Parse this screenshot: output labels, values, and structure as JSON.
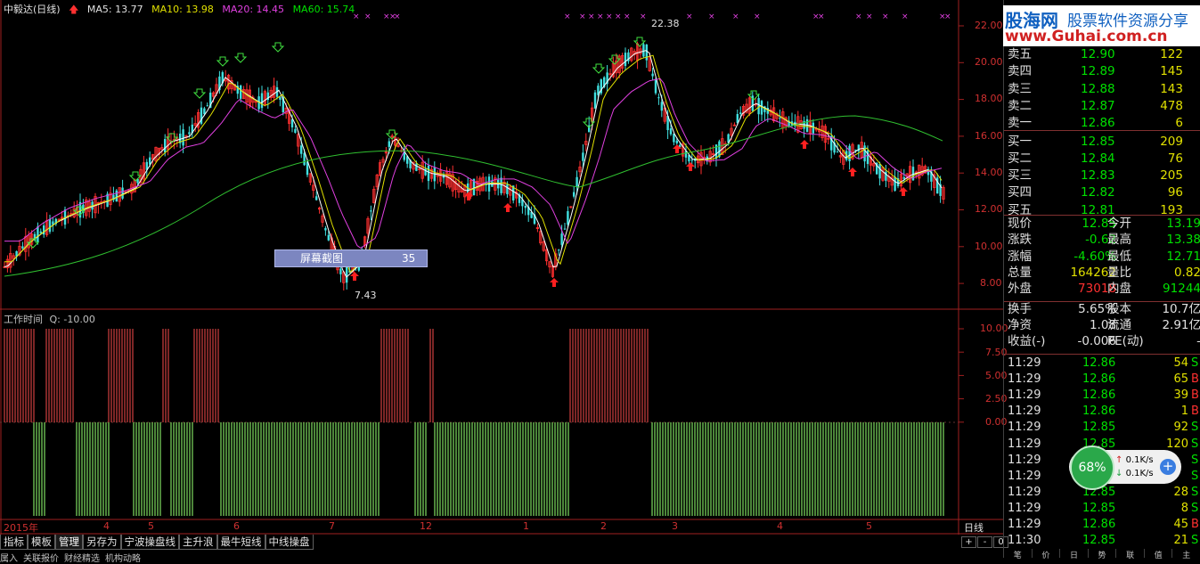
{
  "header": {
    "stock": "中毅达(日线)",
    "ma5": "MA5: 13.77",
    "ma10": "MA10: 13.98",
    "ma20": "MA20: 14.45",
    "ma60": "MA60: 15.74"
  },
  "price_axis": [
    "22.00",
    "20.00",
    "18.00",
    "16.00",
    "14.00",
    "12.00",
    "10.00",
    "8.00"
  ],
  "annotations": {
    "high": "22.38",
    "low": "7.43"
  },
  "overlay": {
    "label": "屏幕截图",
    "value": "35"
  },
  "indicator": {
    "title": "工作时间",
    "q": "Q: -10.00",
    "axis": [
      "10.00",
      "7.50",
      "5.00",
      "2.50",
      "0.00"
    ]
  },
  "dates": [
    "2015年",
    "4",
    "5",
    "6",
    "7",
    "12",
    "1",
    "2",
    "3",
    "4",
    "5"
  ],
  "day_label": "日线",
  "nav": [
    "+",
    "-",
    "0"
  ],
  "tabs": [
    "指标",
    "模板",
    "管理",
    "另存为",
    "宁波操盘线",
    "主升浪",
    "最牛短线",
    "中线操盘"
  ],
  "subtabs": [
    "属入",
    "关联报价",
    "财经精选",
    "机构动略"
  ],
  "logo": {
    "site": "股海网",
    "slogan": "股票软件资源分享",
    "url": "www.Guhai.com.cn"
  },
  "order_book": [
    {
      "label": "卖五",
      "price": "12.90",
      "vol": "122"
    },
    {
      "label": "卖四",
      "price": "12.89",
      "vol": "145"
    },
    {
      "label": "卖三",
      "price": "12.88",
      "vol": "143"
    },
    {
      "label": "卖二",
      "price": "12.87",
      "vol": "478"
    },
    {
      "label": "卖一",
      "price": "12.86",
      "vol": "6"
    },
    {
      "label": "买一",
      "price": "12.85",
      "vol": "209"
    },
    {
      "label": "买二",
      "price": "12.84",
      "vol": "76"
    },
    {
      "label": "买三",
      "price": "12.83",
      "vol": "205"
    },
    {
      "label": "买四",
      "price": "12.82",
      "vol": "96"
    },
    {
      "label": "买五",
      "price": "12.81",
      "vol": "193"
    }
  ],
  "quote": [
    {
      "l1": "现价",
      "v1": "12.85",
      "c1": "#00e000",
      "l2": "今开",
      "v2": "13.19",
      "c2": "#00e000"
    },
    {
      "l1": "涨跌",
      "v1": "-0.62",
      "c1": "#00e000",
      "l2": "最高",
      "v2": "13.38",
      "c2": "#00e000"
    },
    {
      "l1": "涨幅",
      "v1": "-4.60%",
      "c1": "#00e000",
      "l2": "最低",
      "v2": "12.71",
      "c2": "#00e000"
    },
    {
      "l1": "总量",
      "v1": "164262",
      "c1": "#e0e000",
      "l2": "量比",
      "v2": "0.82",
      "c2": "#e0e000"
    },
    {
      "l1": "外盘",
      "v1": "73018",
      "c1": "#ff3030",
      "l2": "内盘",
      "v2": "91244",
      "c2": "#00e000"
    },
    {
      "l1": "换手",
      "v1": "5.65%",
      "c1": "#e0e0e0",
      "l2": "股本",
      "v2": "10.7亿",
      "c2": "#e0e0e0"
    },
    {
      "l1": "净资",
      "v1": "1.08",
      "c1": "#e0e0e0",
      "l2": "流通",
      "v2": "2.91亿",
      "c2": "#e0e0e0"
    },
    {
      "l1": "收益(-)",
      "v1": "-0.006",
      "c1": "#e0e0e0",
      "l2": "PE(动)",
      "v2": "-",
      "c2": "#e0e0e0"
    }
  ],
  "ticks": [
    {
      "time": "11:29",
      "price": "12.86",
      "vol": "54",
      "dir": "S"
    },
    {
      "time": "11:29",
      "price": "12.86",
      "vol": "65",
      "dir": "B"
    },
    {
      "time": "11:29",
      "price": "12.86",
      "vol": "39",
      "dir": "B"
    },
    {
      "time": "11:29",
      "price": "12.86",
      "vol": "1",
      "dir": "B"
    },
    {
      "time": "11:29",
      "price": "12.85",
      "vol": "92",
      "dir": "S"
    },
    {
      "time": "11:29",
      "price": "12.85",
      "vol": "120",
      "dir": "S"
    },
    {
      "time": "11:29",
      "price": "12.85",
      "vol": "",
      "dir": "S"
    },
    {
      "time": "11:29",
      "price": "12.85",
      "vol": "",
      "dir": "S"
    },
    {
      "time": "11:29",
      "price": "12.85",
      "vol": "28",
      "dir": "S"
    },
    {
      "time": "11:29",
      "price": "12.85",
      "vol": "8",
      "dir": "S"
    },
    {
      "time": "11:29",
      "price": "12.86",
      "vol": "45",
      "dir": "B"
    },
    {
      "time": "11:30",
      "price": "12.85",
      "vol": "21",
      "dir": "S"
    }
  ],
  "net_widget": {
    "percent": "68%",
    "up": "0.1K/s",
    "down": "0.1K/s"
  },
  "footer_tabs": [
    "笔",
    "价",
    "日",
    "势",
    "联",
    "值",
    "主"
  ]
}
